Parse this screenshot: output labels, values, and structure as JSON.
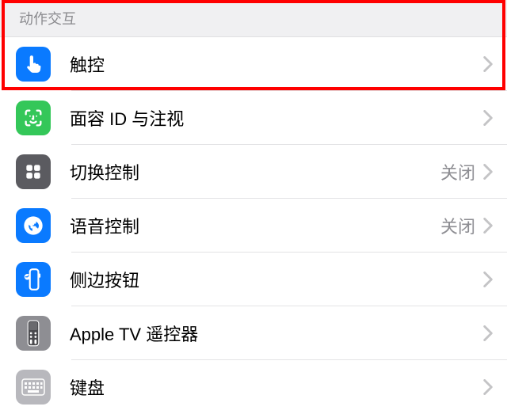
{
  "section": {
    "header": "动作交互"
  },
  "items": [
    {
      "label": "触控",
      "detail": ""
    },
    {
      "label": "面容 ID 与注视",
      "detail": ""
    },
    {
      "label": "切换控制",
      "detail": "关闭"
    },
    {
      "label": "语音控制",
      "detail": "关闭"
    },
    {
      "label": "侧边按钮",
      "detail": ""
    },
    {
      "label": "Apple TV 遥控器",
      "detail": ""
    },
    {
      "label": "键盘",
      "detail": ""
    }
  ]
}
